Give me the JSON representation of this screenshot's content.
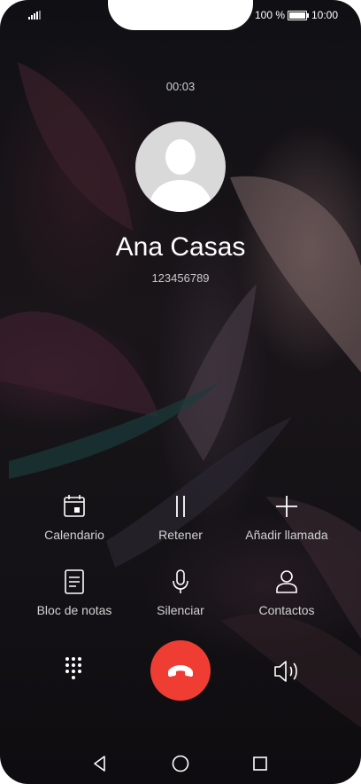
{
  "status_bar": {
    "battery_text": "100 %",
    "battery_level": 1.0,
    "time": "10:00",
    "signal_icon": "signal-icon",
    "battery_icon": "battery-icon"
  },
  "call": {
    "timer": "00:03",
    "caller_name": "Ana Casas",
    "caller_number": "123456789",
    "avatar_icon": "person-silhouette-icon"
  },
  "actions": [
    {
      "label": "Calendario",
      "icon": "calendar-icon"
    },
    {
      "label": "Retener",
      "icon": "pause-icon"
    },
    {
      "label": "Añadir llamada",
      "icon": "plus-icon"
    },
    {
      "label": "Bloc de notas",
      "icon": "notepad-icon"
    },
    {
      "label": "Silenciar",
      "icon": "microphone-icon"
    },
    {
      "label": "Contactos",
      "icon": "contact-icon"
    }
  ],
  "bottom_controls": {
    "keypad_icon": "dialpad-icon",
    "end_call_icon": "phone-hangup-icon",
    "end_call_color": "#ef3d33",
    "speaker_icon": "speaker-icon"
  },
  "nav_bar": {
    "back_icon": "back-triangle-icon",
    "home_icon": "home-circle-icon",
    "recents_icon": "recents-square-icon"
  }
}
